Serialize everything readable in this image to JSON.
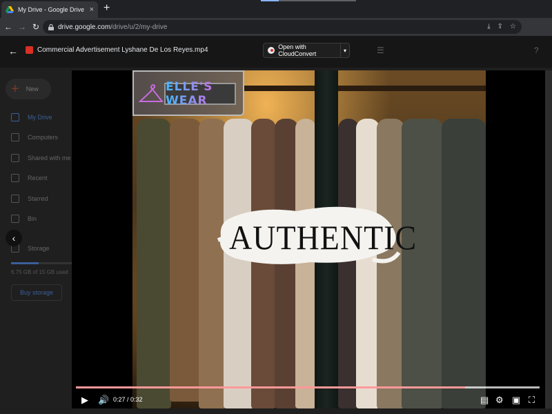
{
  "browser": {
    "tab_title": "My Drive - Google Drive",
    "tab_close": "×",
    "new_tab": "+",
    "url_main": "drive.google.com",
    "url_path": "/drive/u/2/my-drive",
    "nav": {
      "back": "←",
      "forward": "→",
      "reload": "↻"
    },
    "toolbar_icons": [
      "download-icon",
      "share-icon",
      "star-icon"
    ]
  },
  "viewer": {
    "file_name": "Commercial Advertisement Lyshane De Los Reyes.mp4",
    "open_with_label": "Open with CloudConvert",
    "open_with_caret": "▾",
    "back_icon": "←"
  },
  "sidebar": {
    "new_label": "New",
    "items": [
      {
        "label": "My Drive",
        "icon": "drive-icon"
      },
      {
        "label": "Computers",
        "icon": "computer-icon"
      },
      {
        "label": "Shared with me",
        "icon": "people-icon"
      },
      {
        "label": "Recent",
        "icon": "clock-icon"
      },
      {
        "label": "Starred",
        "icon": "star-icon"
      },
      {
        "label": "Bin",
        "icon": "trash-icon"
      },
      {
        "label": "Storage",
        "icon": "cloud-icon"
      }
    ],
    "storage_text": "6.75 GB of 15 GB used",
    "storage_fraction": 0.45,
    "buy_storage": "Buy storage"
  },
  "video": {
    "brand": "ELLE'S WEAR",
    "headline": "AUTHENTIC",
    "current_time": "0:27",
    "duration": "0:32",
    "time_display": "0:27 / 0:32",
    "progress": 0.84
  },
  "colors": {
    "accent_red": "#ff0000",
    "drive_blue": "#3a5f9a",
    "logo_gradient": [
      "#46b8ff",
      "#ff4fd8"
    ]
  }
}
